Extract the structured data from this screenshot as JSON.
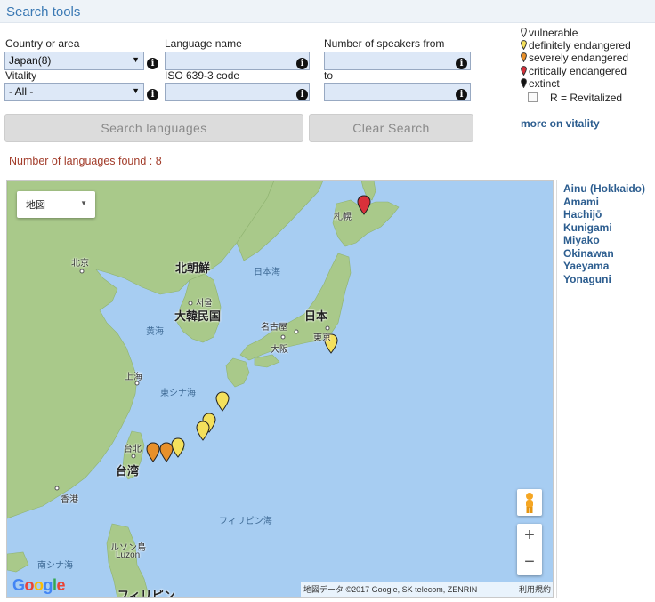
{
  "header": {
    "title": "Search tools"
  },
  "form": {
    "country": {
      "label": "Country or area",
      "value": "Japan(8)"
    },
    "language_name": {
      "label": "Language name",
      "value": ""
    },
    "speakers_from": {
      "label": "Number of speakers from",
      "value": ""
    },
    "vitality": {
      "label": "Vitality",
      "value": "- All -"
    },
    "iso": {
      "label": "ISO 639-3 code",
      "value": ""
    },
    "speakers_to": {
      "label": "to",
      "value": ""
    },
    "info_glyph": "i",
    "caret_glyph": "▼"
  },
  "buttons": {
    "search": "Search languages",
    "clear": "Clear Search"
  },
  "results": {
    "found_text": "Number of languages found : 8"
  },
  "legend": {
    "items": [
      {
        "label": "vulnerable",
        "color": "#f7f7f7"
      },
      {
        "label": "definitely endangered",
        "color": "#f4e05c"
      },
      {
        "label": "severely endangered",
        "color": "#e8902a"
      },
      {
        "label": "critically endangered",
        "color": "#d9303a"
      },
      {
        "label": "extinct",
        "color": "#111111"
      }
    ],
    "revitalized_label": "R = Revitalized",
    "more_link": "more on vitality"
  },
  "map": {
    "type_control": "地図",
    "labels": {
      "sapporo": "札幌",
      "beijing": "北京",
      "north_korea": "北朝鮮",
      "sea_of_japan": "日本海",
      "seoul": "서울",
      "south_korea": "大韓民国",
      "japan": "日本",
      "nagoya": "名古屋",
      "tokyo": "東京",
      "osaka": "大阪",
      "yellow_sea": "黄海",
      "shanghai": "上海",
      "east_china_sea": "東シナ海",
      "taipei": "台北",
      "taiwan": "台湾",
      "hong_kong": "香港",
      "philippine_sea": "フィリピン海",
      "luzon_jp": "ルソン島",
      "luzon": "Luzon",
      "south_china_sea": "南シナ海",
      "philippines": "フィリピン"
    },
    "zoom_in": "+",
    "zoom_out": "−",
    "attribution": "地図データ ©2017 Google, SK telecom, ZENRIN",
    "terms": "利用規約",
    "logo": {
      "g1": "G",
      "o1": "o",
      "o2": "o",
      "g2": "g",
      "l": "l",
      "e": "e"
    },
    "logo_colors": [
      "#4285f4",
      "#ea4335",
      "#fbbc05",
      "#4285f4",
      "#34a853",
      "#ea4335"
    ],
    "marker_colors": {
      "critical": "#d9303a",
      "severe": "#e8902a",
      "definite": "#f4e05c"
    },
    "colors": {
      "water": "#a7cdf2",
      "land": "#a9c98a",
      "land_dark": "#8fb370"
    }
  },
  "languages": [
    "Ainu (Hokkaido)",
    "Amami",
    "Hachijō",
    "Kunigami",
    "Miyako",
    "Okinawan",
    "Yaeyama",
    "Yonaguni"
  ]
}
